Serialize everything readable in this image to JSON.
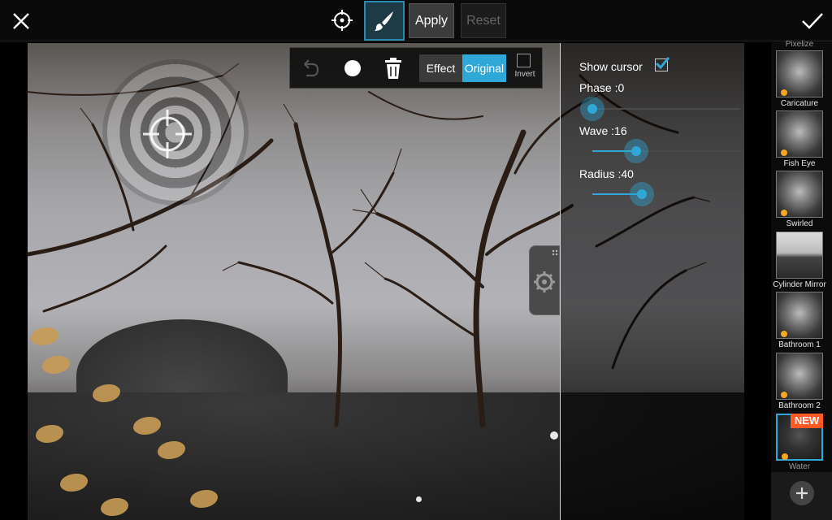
{
  "toolbar": {
    "apply_label": "Apply",
    "reset_label": "Reset",
    "icons": [
      "close-icon",
      "crosshair-icon",
      "brush-icon",
      "checkmark-icon"
    ]
  },
  "brush_popup": {
    "effect_label": "Effect",
    "original_label": "Original",
    "invert_label": "Invert",
    "selected_mode": "Original",
    "invert_checked": false
  },
  "settings": {
    "show_cursor_label": "Show cursor",
    "show_cursor_checked": true,
    "phase_label": "Phase :0",
    "phase_value": 0,
    "wave_label": "Wave :16",
    "wave_value": 16,
    "radius_label": "Radius :40",
    "radius_value": 40
  },
  "effects": {
    "items": [
      {
        "name": "Pixelize"
      },
      {
        "name": "Caricature"
      },
      {
        "name": "Fish Eye"
      },
      {
        "name": "Swirled"
      },
      {
        "name": "Cylinder Mirror"
      },
      {
        "name": "Bathroom 1"
      },
      {
        "name": "Bathroom 2"
      },
      {
        "name": "Water"
      }
    ],
    "selected": "Water",
    "new_badge": "NEW"
  },
  "colors": {
    "accent": "#2fa8d8",
    "badge": "#ff5a24"
  }
}
